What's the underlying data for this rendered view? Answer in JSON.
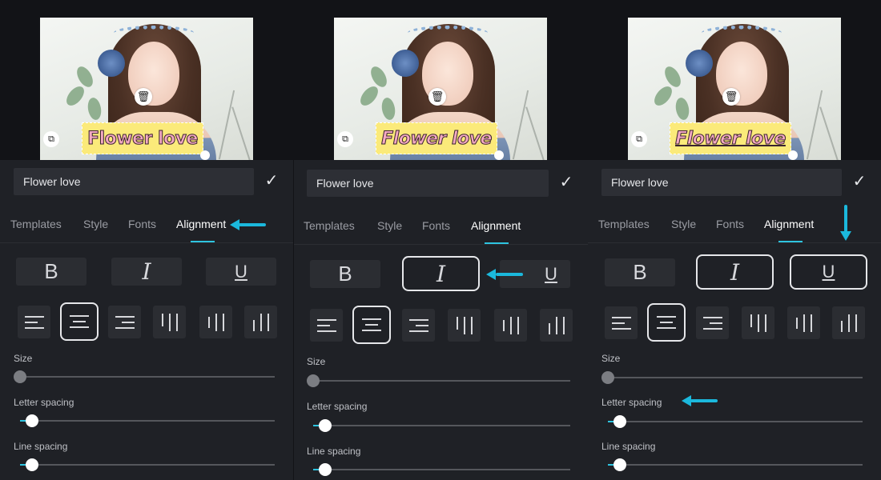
{
  "sticker_text": "Flower love",
  "text_input_value": "Flower love",
  "tabs": [
    "Templates",
    "Style",
    "Fonts",
    "Alignment"
  ],
  "active_tab": "Alignment",
  "format_buttons": {
    "bold": "B",
    "italic": "I",
    "underline": "U"
  },
  "icons": {
    "confirm": "checkmark-icon",
    "delete": "trash-icon",
    "copy": "copy-icon",
    "arrow": "arrow-icon"
  },
  "settings": {
    "size_label": "Size",
    "letter_spacing_label": "Letter spacing",
    "line_spacing_label": "Line spacing"
  },
  "colors": {
    "accent": "#2ec4e0",
    "annotation_arrow": "#1bb8dc",
    "sticker_background": "#fbea7a",
    "sticker_text": "#f4a9c3",
    "editor_background": "#1f2126"
  },
  "panels": [
    {
      "italic_selected": false,
      "underline_selected": false,
      "selected_alignment": "center",
      "size_value": 0,
      "letter_spacing_value": 0.05,
      "line_spacing_value": 0.05
    },
    {
      "italic_selected": true,
      "underline_selected": false,
      "selected_alignment": "center",
      "size_value": 0,
      "letter_spacing_value": 0.05,
      "line_spacing_value": 0.05
    },
    {
      "italic_selected": true,
      "underline_selected": true,
      "selected_alignment": "center",
      "size_value": 0,
      "letter_spacing_value": 0.05,
      "line_spacing_value": 0.05
    }
  ]
}
